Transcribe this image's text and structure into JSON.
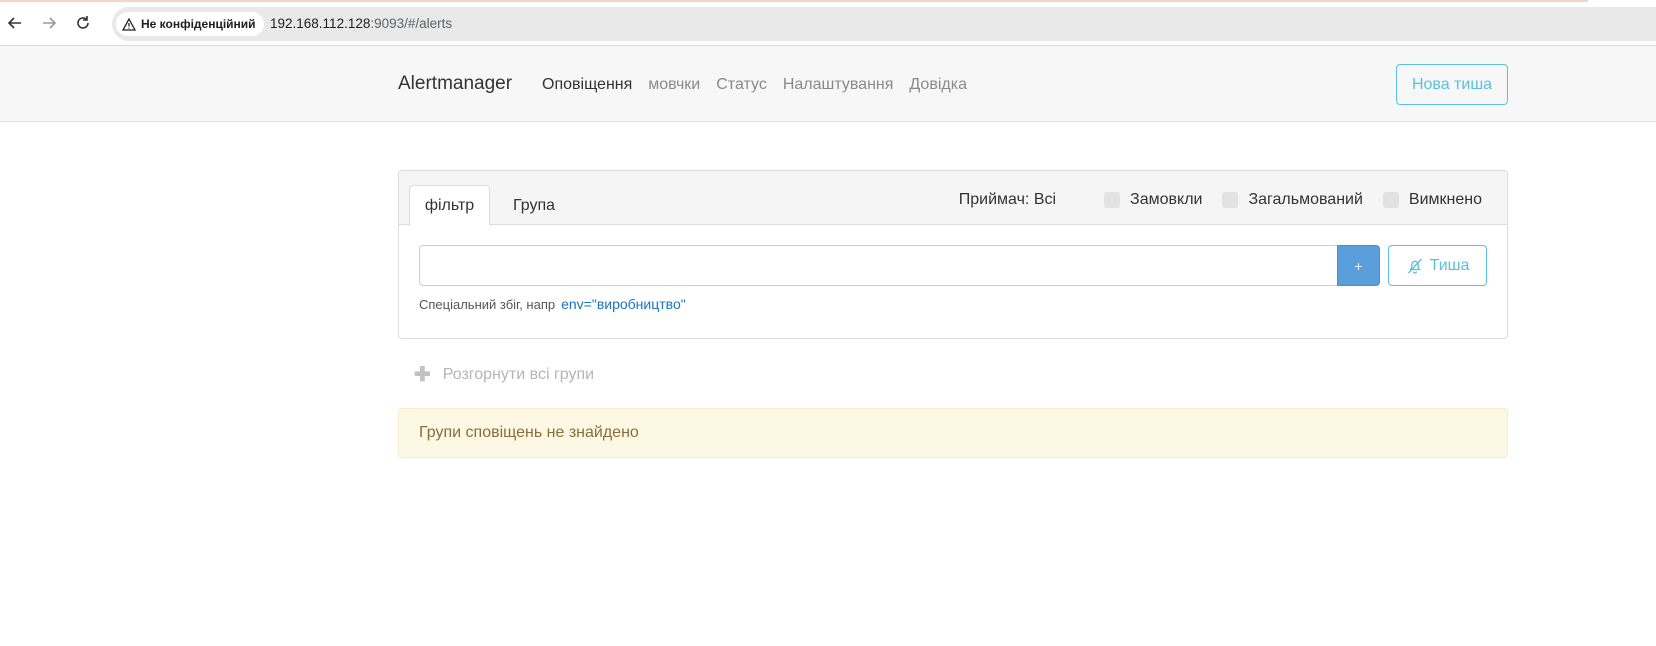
{
  "browser": {
    "security_label": "Не конфіденційний",
    "url_host": "192.168.112.128",
    "url_rest": ":9093/#/alerts"
  },
  "navbar": {
    "brand": "Alertmanager",
    "links": [
      "Оповіщення",
      "мовчки",
      "Статус",
      "Налаштування",
      "Довідка"
    ],
    "active_index": 0,
    "new_silence_label": "Нова тиша"
  },
  "filter": {
    "tabs": [
      "фільтр",
      "Група"
    ],
    "receiver_label": "Приймач: Всі",
    "checkboxes": [
      "Замовкли",
      "Загальмований",
      "Вимкнено"
    ],
    "input_value": "",
    "add_label": "+",
    "silence_label": "Тиша",
    "hint_text": "Спеціальний збіг, напр",
    "hint_example": "env=\"виробництво\""
  },
  "expand_all_label": "Розгорнути всі групи",
  "alert_message": "Групи сповіщень не знайдено",
  "colors": {
    "accent_info": "#5bc0de",
    "primary": "#5a9fdc",
    "warning_bg": "#fcf8e3",
    "warning_text": "#8a6d3b"
  }
}
